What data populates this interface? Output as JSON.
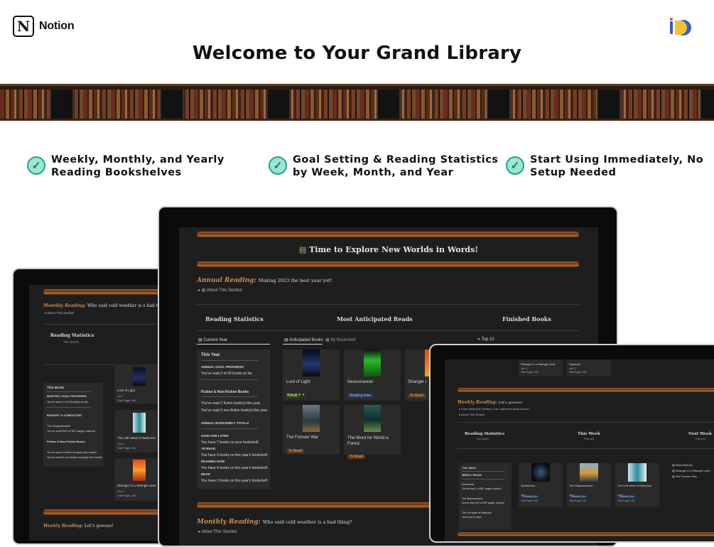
{
  "header": {
    "logo_glyph": "N",
    "brand_name": "Notion",
    "title": "Welcome to Your Grand Library"
  },
  "features": [
    {
      "line1": "Weekly, Monthly, and Yearly",
      "line2": "Reading Bookshelves"
    },
    {
      "line1": "Goal Setting & Reading Statistics",
      "line2": "by Week, Month, and Year"
    },
    {
      "line1": "Start Using Immediately, No",
      "line2": "Setup Needed"
    }
  ],
  "colors": {
    "check_fill": "#9fe3d2",
    "check_border": "#1aa890",
    "screen_bg": "#1e1e1e",
    "accent_gold": "#c98d5a"
  },
  "center": {
    "heading": "Time to Explore New Worlds in Words!",
    "annual_label": "Annual Reading:",
    "annual_text": "Making 2023 the best year yet!",
    "about": "About This Section",
    "col_stats": "Reading Statistics",
    "col_anticipated": "Most Anticipated Reads",
    "col_finished": "Finished Books",
    "tab_current_year": "Current Year",
    "tab_anticipated": "Anticipated Books",
    "tab_by_bookshelf": "By Bookshelf",
    "tab_top10": "Top 10",
    "this_year": "This Year",
    "annual_goal": "ANNUAL GOAL PROGRESS",
    "goal_line": "You've read 2 of 30 books so far.",
    "fiction_title": "Fiction & Non-Fiction Books",
    "fiction_line": "You've read 2 fiction book(s) this year.",
    "nonfiction_line": "You've read 0 non-fiction book(s) this year.",
    "totals_title": "ANNUAL BOOKSHELF TOTALS",
    "save_later": "SAVE FOR LATER",
    "save_line": "You have 7 books on your bookshelf.",
    "to_read": "TO READ",
    "to_read_line": "You have 9 books on this year's bookshelf.",
    "reading_now": "READING NOW",
    "reading_now_line": "You have 4 books on this year's bookshelf.",
    "read": "READ",
    "read_line": "You have 2 books on this year's bookshelf.",
    "books": [
      {
        "title": "Lord of Light",
        "tag": "Read",
        "stars": "★★★★★"
      },
      {
        "title": "Neuromancer",
        "tag": "Reading Now"
      },
      {
        "title": "Stranger i",
        "tag": "To Read"
      },
      {
        "title": "The Forever War",
        "tag": "To Read"
      },
      {
        "title": "The Word for World is Forest",
        "tag": "To Read"
      }
    ],
    "monthly_label": "Monthly Reading:",
    "monthly_text": "Who said cold weather is a bad thing?",
    "about2": "About This Section"
  },
  "left": {
    "monthly_label": "Monthly Reading:",
    "monthly_text": "Who said cold weather is a bad thing",
    "about": "About This Section",
    "stats": "Reading Statistics",
    "stats_sub": "This Month",
    "this_month": "This Month",
    "goal": "MONTHLY GOAL PROGRESS",
    "goal_line": "You've read 1 of 3 book(s) so far.",
    "biggest": "BIGGEST % COMPLETED",
    "disp": "The Dispossessed",
    "disp_line": "You've read 302 of 387 pages, wahoo!",
    "fiction": "Fiction & Non-Fiction Books",
    "fic_line": "You've read 1 fiction book(s) this month.",
    "nonfic_line": "You've read 0 non-fiction book(s) this month.",
    "books": [
      {
        "title": "Lord of Light",
        "meta1": "Jan 7",
        "meta2": "Total Pages: 296"
      },
      {
        "title": "The Left Hand of Darkness",
        "meta1": "Jan 8",
        "meta2": "Total Pages: 304"
      },
      {
        "title": "Stranger in a Strange Land",
        "meta1": "Jan 17",
        "meta2": "Total Pages: 438"
      }
    ],
    "weekly_label": "Weekly Reading:",
    "weekly_text": "Let's gooooo!"
  },
  "right": {
    "top_book1": "Stranger in a Strange Land",
    "top_book1_meta1": "Jan 17",
    "top_book1_meta2": "Total Pages: 438",
    "top_book2": "Hyperion",
    "top_book2_meta1": "Jan 21",
    "top_book2_meta2": "Total Pages: 481",
    "weekly_label": "Weekly Reading:",
    "weekly_text": "Let's gooooo!",
    "quote": "From Kabir (the creator): Can I ask them quick favors?",
    "about": "About This Section",
    "stats": "Reading Statistics",
    "stats_sub": "This Week",
    "this_week": "This Week",
    "planned": "Planned",
    "next_week": "Next Week",
    "planned2": "Planned",
    "panel_title": "This Week",
    "weekly_reads": "WEEKLY READS",
    "r1": "Seveneves",
    "r1_line": "You've read 1 of 867 pages, wahoo!",
    "r2": "The Dispossessed",
    "r2_line": "You've read 302 of 387 pages, wahoo!",
    "r3": "The Left Hand of Darkness",
    "r3_line": "You're yet to start.",
    "books": [
      {
        "title": "Seveneves",
        "tag": "Reading Now",
        "meta1": "Jan 1",
        "meta2": "Total Pages: 867"
      },
      {
        "title": "The Dispossessed",
        "tag": "Reading Now",
        "meta1": "Jan 6",
        "meta2": "Total Pages: 387"
      },
      {
        "title": "The Left Hand of Darkness",
        "tag": "Reading Now",
        "meta1": "Jan 8",
        "meta2": "Total Pages: 304"
      }
    ],
    "next_list": [
      "Neuromancer",
      "Stranger in a Strange Land",
      "The Forever War"
    ]
  }
}
